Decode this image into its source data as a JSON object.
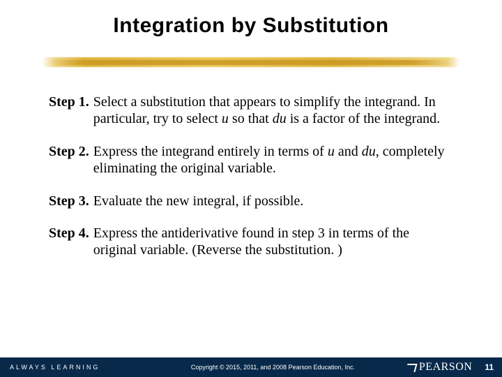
{
  "title": "Integration by Substitution",
  "steps": [
    {
      "label": "Step 1.",
      "parts": [
        {
          "t": "Select a substitution that appears to simplify the integrand. In particular, try to select "
        },
        {
          "t": "u",
          "em": true
        },
        {
          "t": " so that "
        },
        {
          "t": "du",
          "em": true
        },
        {
          "t": " is a factor of the integrand."
        }
      ]
    },
    {
      "label": "Step 2.",
      "parts": [
        {
          "t": "Express the integrand entirely in terms of "
        },
        {
          "t": "u",
          "em": true
        },
        {
          "t": " and "
        },
        {
          "t": "du",
          "em": true
        },
        {
          "t": ", completely eliminating the original variable."
        }
      ]
    },
    {
      "label": "Step 3.",
      "parts": [
        {
          "t": "Evaluate the new integral, if possible."
        }
      ]
    },
    {
      "label": "Step 4.",
      "parts": [
        {
          "t": "Express the antiderivative found in step 3 in terms of the original variable. (Reverse the substitution. )"
        }
      ]
    }
  ],
  "footer": {
    "tagline": "ALWAYS LEARNING",
    "copyright": "Copyright © 2015, 2011, and 2008 Pearson Education, Inc.",
    "brand": "PEARSON",
    "page": "11"
  }
}
